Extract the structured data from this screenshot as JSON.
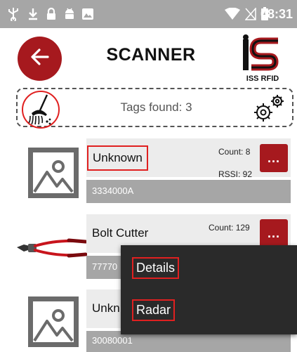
{
  "status_bar": {
    "time": "08:31",
    "icons": [
      "usb-icon",
      "download-icon",
      "lock-icon",
      "android-icon",
      "image-icon",
      "wifi-icon",
      "signal-icon",
      "battery-icon"
    ]
  },
  "header": {
    "title": "SCANNER",
    "logo_text": "ISS RFID",
    "back_icon": "back-arrow-icon"
  },
  "toolbar": {
    "tags_found": "Tags found: 3",
    "clear_icon": "broom-icon",
    "settings_icon": "gears-icon"
  },
  "tags": [
    {
      "name": "Unknown",
      "count": "Count: 8",
      "rssi": "RSSI: 92",
      "epc": "3334000A",
      "thumb": "image-placeholder-icon"
    },
    {
      "name": "Bolt Cutter",
      "count": "Count: 129",
      "epc": "77770",
      "thumb": "bolt-cutter-image"
    },
    {
      "name": "Unkn",
      "epc": "30080001",
      "thumb": "image-placeholder-icon"
    }
  ],
  "more_label": "...",
  "context_menu": {
    "items": [
      {
        "label": "Details"
      },
      {
        "label": "Radar"
      }
    ]
  },
  "colors": {
    "status_bar": "#a6a6a6",
    "accent": "#a6191e",
    "card": "#ececec",
    "card_footer": "#a6a6a6",
    "menu": "#2a2a2a",
    "highlight": "#e02020"
  }
}
